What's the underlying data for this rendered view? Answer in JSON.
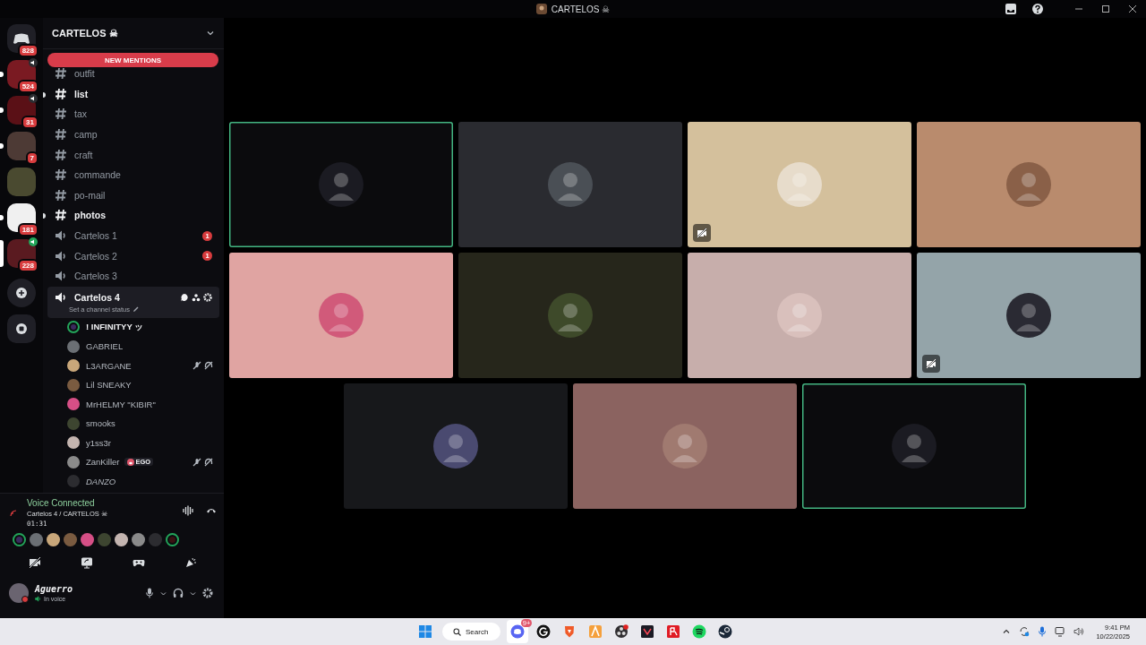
{
  "window": {
    "title": "CARTELOS ☠"
  },
  "servers": [
    {
      "badge": "828",
      "unread": false,
      "voice": false,
      "selected": false,
      "kind": "home"
    },
    {
      "badge": "524",
      "unread": true,
      "voice": true,
      "selected": false,
      "kind": "server"
    },
    {
      "badge": "31",
      "unread": true,
      "voice": true,
      "selected": false,
      "kind": "server"
    },
    {
      "badge": "7",
      "unread": true,
      "voice": false,
      "selected": false,
      "kind": "server"
    },
    {
      "unread": false,
      "voice": false,
      "selected": false,
      "kind": "server"
    },
    {
      "badge": "181",
      "unread": true,
      "voice": false,
      "selected": false,
      "kind": "server"
    },
    {
      "badge": "228",
      "voice": true,
      "kind": "server",
      "selected": true
    },
    {
      "kind": "add"
    },
    {
      "kind": "discover"
    }
  ],
  "server_name": "CARTELOS ☠",
  "new_mentions": "NEW MENTIONS",
  "channels": [
    {
      "name": "outfit",
      "kind": "text",
      "unread": false,
      "selected": false
    },
    {
      "name": "list",
      "kind": "text",
      "unread": true,
      "selected": false
    },
    {
      "name": "tax",
      "kind": "text",
      "unread": false,
      "selected": false
    },
    {
      "name": "camp",
      "kind": "text",
      "unread": false,
      "selected": false
    },
    {
      "name": "craft",
      "kind": "text",
      "unread": false,
      "selected": false
    },
    {
      "name": "commande",
      "kind": "text",
      "unread": false,
      "selected": false
    },
    {
      "name": "po-mail",
      "kind": "text",
      "unread": false,
      "selected": false
    },
    {
      "name": "photos",
      "kind": "text",
      "unread": true,
      "selected": false
    },
    {
      "name": "Cartelos 1",
      "kind": "voice",
      "unread": false,
      "selected": false,
      "mentions": "1"
    },
    {
      "name": "Cartelos 2",
      "kind": "voice",
      "unread": false,
      "selected": false,
      "mentions": "1"
    },
    {
      "name": "Cartelos 3",
      "kind": "voice",
      "unread": false,
      "selected": false
    },
    {
      "name": "Cartelos 4",
      "kind": "voice",
      "selected": true,
      "status": "Set a channel status",
      "members": [
        {
          "name": "! INFINITYY ッ",
          "speaking": true,
          "muted": false,
          "deafened": false,
          "italic": false
        },
        {
          "name": "GABRIEL",
          "speaking": false,
          "muted": false,
          "deafened": false,
          "italic": false
        },
        {
          "name": "L3ARGANE",
          "speaking": false,
          "muted": true,
          "deafened": true,
          "italic": false
        },
        {
          "name": "Lil SNEAKY",
          "speaking": false,
          "muted": false,
          "deafened": false,
          "italic": false
        },
        {
          "name": "MrHELMY \"KIBIR\"",
          "speaking": false,
          "muted": false,
          "deafened": false,
          "italic": false
        },
        {
          "name": "smooks",
          "speaking": false,
          "muted": false,
          "deafened": false,
          "italic": false
        },
        {
          "name": "y1ss3r",
          "speaking": false,
          "muted": false,
          "deafened": false,
          "italic": false
        },
        {
          "name": "ZanKiller",
          "tag": "EGO",
          "speaking": false,
          "muted": true,
          "deafened": true,
          "italic": false
        },
        {
          "name": "DANZO",
          "speaking": false,
          "muted": false,
          "deafened": false,
          "italic": true
        }
      ]
    }
  ],
  "voice_panel": {
    "title": "Voice Connected",
    "location": "Cartelos 4 / CARTELOS ☠",
    "timer": "01:31",
    "participants": [
      {
        "speaking": true
      },
      {
        "speaking": false
      },
      {
        "speaking": false
      },
      {
        "speaking": false
      },
      {
        "speaking": false
      },
      {
        "speaking": false
      },
      {
        "speaking": false
      },
      {
        "speaking": false
      },
      {
        "speaking": false
      },
      {
        "speaking": true
      }
    ]
  },
  "user": {
    "name": "Aguerro",
    "status": "In voice"
  },
  "tiles": [
    {
      "color": "#0b0b0d",
      "speaking": true,
      "camera_off_badge": false
    },
    {
      "color": "#2a2b30",
      "speaking": false,
      "camera_off_badge": false
    },
    {
      "color": "#d4c09c",
      "speaking": false,
      "camera_off_badge": true
    },
    {
      "color": "#b98b6d",
      "speaking": false,
      "camera_off_badge": false
    },
    {
      "color": "#e0a4a2",
      "speaking": false,
      "camera_off_badge": false
    },
    {
      "color": "#26261b",
      "speaking": false,
      "camera_off_badge": false
    },
    {
      "color": "#c7aeab",
      "speaking": false,
      "camera_off_badge": false
    },
    {
      "color": "#94a4a9",
      "speaking": false,
      "camera_off_badge": true
    },
    {
      "color": "#17181b",
      "speaking": false,
      "camera_off_badge": false
    },
    {
      "color": "#8b6360",
      "speaking": false,
      "camera_off_badge": false
    },
    {
      "color": "#0b0b0d",
      "speaking": true,
      "camera_off_badge": false
    }
  ],
  "taskbar": {
    "search": "Search",
    "discord_badge": "9+",
    "time": "9:41 PM",
    "date": "10/22/2025"
  }
}
